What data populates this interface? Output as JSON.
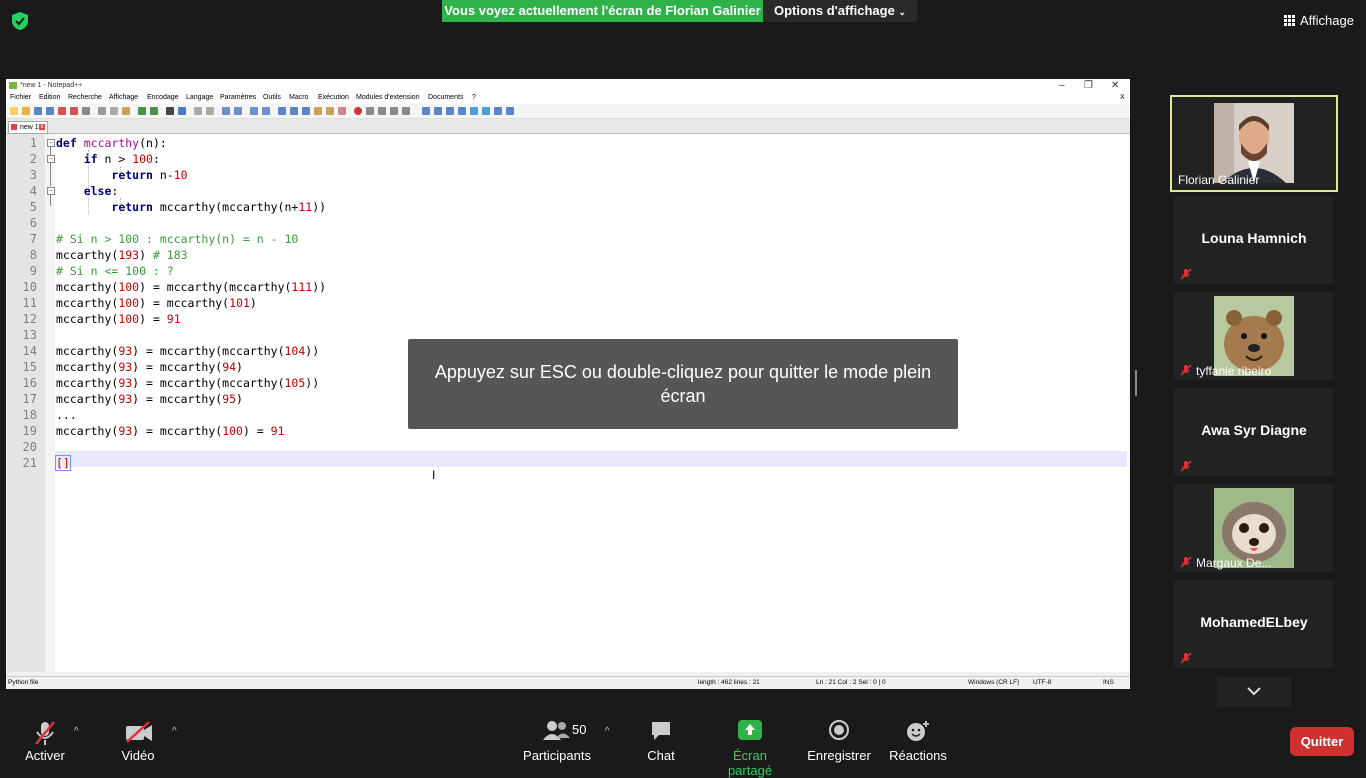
{
  "zoom": {
    "share_banner": "Vous voyez actuellement l'écran de Florian Galinier",
    "view_options": "Options d'affichage",
    "view_button": "Affichage",
    "esc_message": "Appuyez sur ESC ou double-cliquez pour quitter le mode plein écran",
    "participants_count": "50",
    "toolbar": {
      "mute": "Activer",
      "video": "Vidéo",
      "participants": "Participants",
      "chat": "Chat",
      "share": "Écran partagé",
      "record": "Enregistrer",
      "reactions": "Réactions",
      "quit": "Quitter"
    },
    "participants": [
      {
        "name": "Florian Galinier",
        "has_video": true,
        "muted": false
      },
      {
        "name": "Louna Hamnich",
        "has_video": false,
        "muted": true
      },
      {
        "name": "tyffanie ribeiro",
        "has_video": true,
        "muted": true
      },
      {
        "name": "Awa Syr Diagne",
        "has_video": false,
        "muted": true
      },
      {
        "name": "Margaux De...",
        "has_video": true,
        "muted": true
      },
      {
        "name": "MohamedELbey",
        "has_video": false,
        "muted": true
      }
    ]
  },
  "notepad": {
    "title": "*new 1 - Notepad++",
    "menu": [
      "Fichier",
      "Edition",
      "Recherche",
      "Affichage",
      "Encodage",
      "Langage",
      "Paramètres",
      "Outils",
      "Macro",
      "Exécution",
      "Modules d'extension",
      "Documents",
      "?"
    ],
    "tab": "new 1",
    "lines": [
      "def mccarthy(n):",
      "    if n > 100:",
      "        return n-10",
      "    else:",
      "        return mccarthy(mccarthy(n+11))",
      "",
      "# Si n > 100 : mccarthy(n) = n - 10",
      "mccarthy(193) # 183",
      "# Si n <= 100 : ?",
      "mccarthy(100) = mccarthy(mccarthy(111))",
      "mccarthy(100) = mccarthy(101)",
      "mccarthy(100) = 91",
      "",
      "mccarthy(93) = mccarthy(mccarthy(104))",
      "mccarthy(93) = mccarthy(94)",
      "mccarthy(93) = mccarthy(mccarthy(105))",
      "mccarthy(93) = mccarthy(95)",
      "...",
      "mccarthy(93) = mccarthy(100) = 91",
      "",
      "[]"
    ],
    "status": {
      "file_type": "Python file",
      "length": "length : 462    lines : 21",
      "position": "Ln : 21    Col : 2    Sel : 0 | 0",
      "eol": "Windows (CR LF)",
      "encoding": "UTF-8",
      "mode": "INS"
    }
  },
  "colors": {
    "share_green": "#2fb24a",
    "quit_red": "#d0302f",
    "active_speaker_border": "#e4e89a",
    "mute_red": "#e0303a"
  }
}
